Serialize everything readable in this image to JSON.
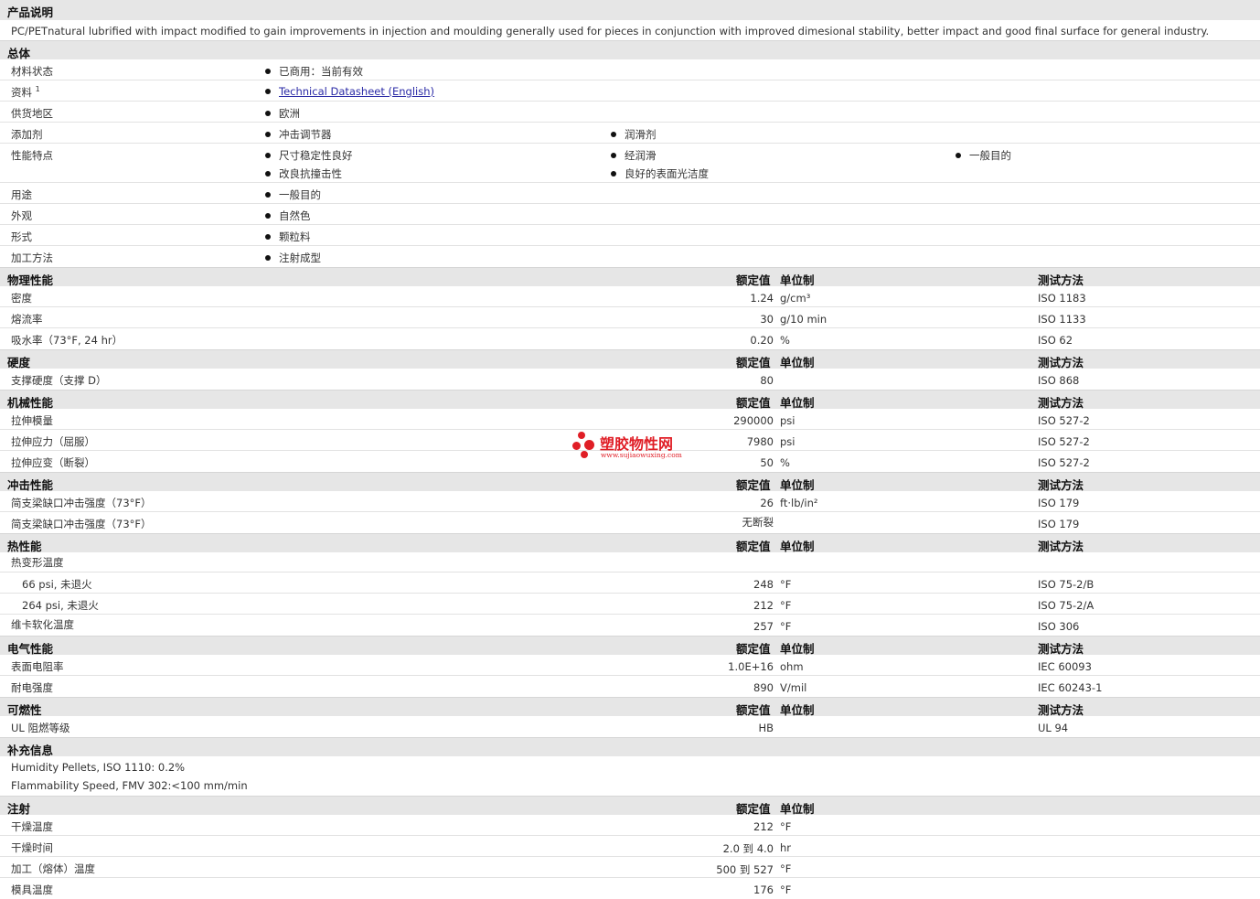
{
  "sections": {
    "desc": {
      "title": "产品说明",
      "text": "PC/PETnatural lubrified with impact modified to gain improvements in injection and moulding generally used for pieces in conjunction with improved dimesional stability, better impact and good final surface for general industry."
    },
    "general": {
      "title": "总体",
      "status_label": "材料状态",
      "status_value": "已商用：当前有效",
      "docs_label": "资料",
      "docs_sup": "1",
      "docs_link": "Technical Datasheet (English)",
      "region_label": "供货地区",
      "region_value": "欧洲",
      "additive_label": "添加剂",
      "additive_1": "冲击调节器",
      "additive_2": "润滑剂",
      "feature_label": "性能特点",
      "feature_1": "尺寸稳定性良好",
      "feature_2": "经润滑",
      "feature_3": "一般目的",
      "feature_4": "改良抗撞击性",
      "feature_5": "良好的表面光洁度",
      "use_label": "用途",
      "use_value": "一般目的",
      "appearance_label": "外观",
      "appearance_value": "自然色",
      "form_label": "形式",
      "form_value": "颗粒料",
      "process_label": "加工方法",
      "process_value": "注射成型"
    },
    "headers": {
      "nominal": "额定值",
      "unit": "单位制",
      "method": "测试方法"
    },
    "physical": {
      "title": "物理性能",
      "rows": [
        {
          "label": "密度",
          "value": "1.24",
          "unit": "g/cm³",
          "method": "ISO 1183"
        },
        {
          "label": "熔流率",
          "value": "30",
          "unit": "g/10 min",
          "method": "ISO 1133"
        },
        {
          "label": "吸水率（73°F, 24 hr）",
          "value": "0.20",
          "unit": "%",
          "method": "ISO 62"
        }
      ]
    },
    "hardness": {
      "title": "硬度",
      "rows": [
        {
          "label": "支撑硬度（支撑 D）",
          "value": "80",
          "unit": "",
          "method": "ISO 868"
        }
      ]
    },
    "mechanical": {
      "title": "机械性能",
      "rows": [
        {
          "label": "拉伸模量",
          "value": "290000",
          "unit": "psi",
          "method": "ISO 527-2"
        },
        {
          "label": "拉伸应力（屈服）",
          "value": "7980",
          "unit": "psi",
          "method": "ISO 527-2"
        },
        {
          "label": "拉伸应变（断裂）",
          "value": "50",
          "unit": "%",
          "method": "ISO 527-2"
        }
      ]
    },
    "impact": {
      "title": "冲击性能",
      "rows": [
        {
          "label": "简支梁缺口冲击强度（73°F）",
          "value": "26",
          "unit": "ft·lb/in²",
          "method": "ISO 179"
        },
        {
          "label": "简支梁缺口冲击强度（73°F）",
          "value": "无断裂",
          "unit": "",
          "method": "ISO 179"
        }
      ]
    },
    "thermal": {
      "title": "热性能",
      "hdt_label": "热变形温度",
      "rows": [
        {
          "label": "66 psi, 未退火",
          "value": "248",
          "unit": "°F",
          "method": "ISO 75-2/B"
        },
        {
          "label": "264 psi, 未退火",
          "value": "212",
          "unit": "°F",
          "method": "ISO 75-2/A"
        },
        {
          "label": "维卡软化温度",
          "value": "257",
          "unit": "°F",
          "method": "ISO 306"
        }
      ]
    },
    "electrical": {
      "title": "电气性能",
      "rows": [
        {
          "label": "表面电阻率",
          "value": "1.0E+16",
          "unit": "ohm",
          "method": "IEC 60093"
        },
        {
          "label": "耐电强度",
          "value": "890",
          "unit": "V/mil",
          "method": "IEC 60243-1"
        }
      ]
    },
    "flammability": {
      "title": "可燃性",
      "rows": [
        {
          "label": "UL 阻燃等级",
          "value": "HB",
          "unit": "",
          "method": "UL 94"
        }
      ]
    },
    "supplement": {
      "title": "补充信息",
      "notes": [
        "Humidity Pellets, ISO 1110: 0.2%",
        "Flammability Speed, FMV 302:<100 mm/min"
      ]
    },
    "injection": {
      "title": "注射",
      "rows": [
        {
          "label": "干燥温度",
          "value": "212",
          "unit": "°F"
        },
        {
          "label": "干燥时间",
          "value": "2.0 到  4.0",
          "unit": "hr"
        },
        {
          "label": "加工（熔体）温度",
          "value": "500 到  527",
          "unit": "°F"
        },
        {
          "label": "模具温度",
          "value": "176",
          "unit": "°F"
        }
      ]
    }
  },
  "watermark": {
    "text": "塑胶物性网",
    "url": "www.sujiaowuxing.com",
    "color": "#e01e26"
  }
}
